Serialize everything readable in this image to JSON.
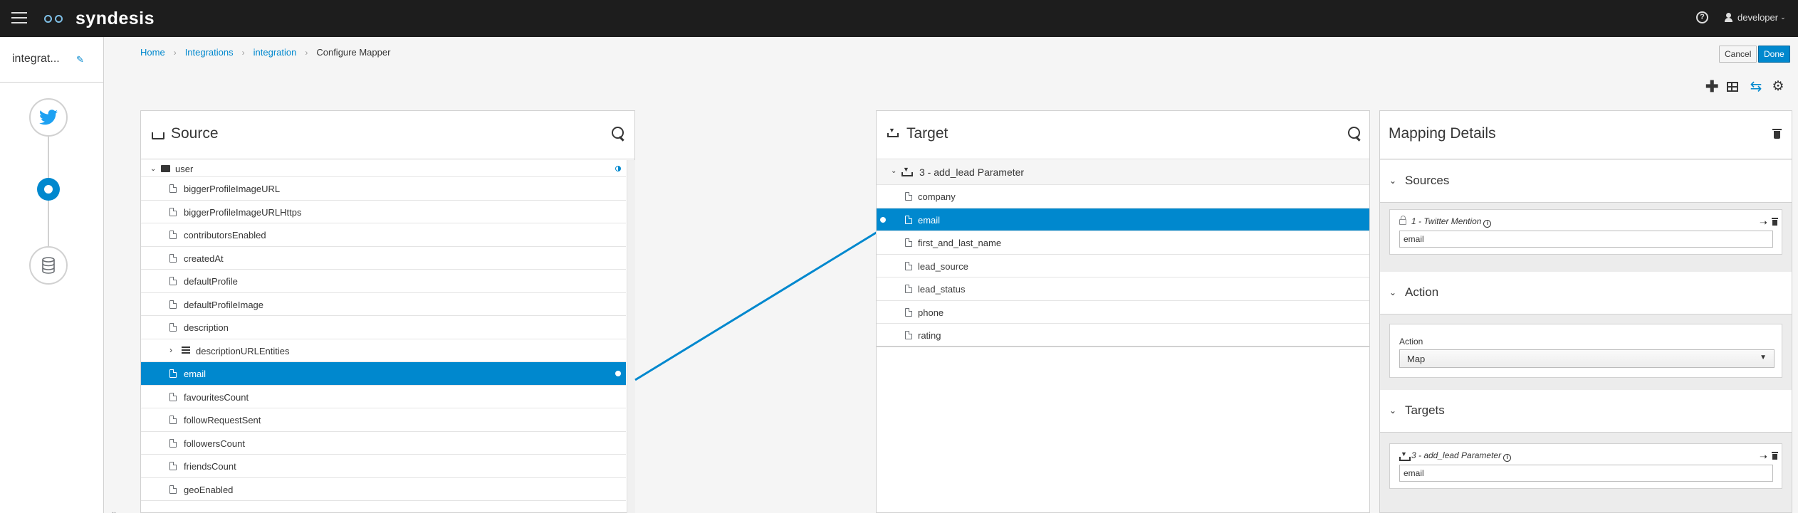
{
  "app": {
    "name": "syndesis"
  },
  "topbar": {
    "user": "developer"
  },
  "rail": {
    "title": "integrat...",
    "collapse_glyph": "»"
  },
  "breadcrumb": {
    "home": "Home",
    "integrations": "Integrations",
    "integration": "integration",
    "current": "Configure Mapper"
  },
  "actions": {
    "cancel": "Cancel",
    "done": "Done"
  },
  "source": {
    "title": "Source",
    "parent": "user",
    "items": [
      "biggerProfileImageURL",
      "biggerProfileImageURLHttps",
      "contributorsEnabled",
      "createdAt",
      "defaultProfile",
      "defaultProfileImage",
      "description",
      "descriptionURLEntities",
      "email",
      "favouritesCount",
      "followRequestSent",
      "followersCount",
      "friendsCount",
      "geoEnabled"
    ],
    "selected": "email"
  },
  "target": {
    "title": "Target",
    "group": "3 - add_lead Parameter",
    "items": [
      "company",
      "email",
      "first_and_last_name",
      "lead_source",
      "lead_status",
      "phone",
      "rating"
    ],
    "selected": "email"
  },
  "details": {
    "title": "Mapping Details",
    "sources_label": "Sources",
    "source_card": {
      "label": "1 - Twitter Mention",
      "value": "email"
    },
    "action_label": "Action",
    "action_field_label": "Action",
    "action_value": "Map",
    "targets_label": "Targets",
    "target_card": {
      "label": "3 - add_lead Parameter",
      "value": "email"
    }
  },
  "colors": {
    "accent": "#0088ce",
    "topbar": "#1d1d1d"
  },
  "icons": [
    "hamburger-icon",
    "help-icon",
    "user-icon",
    "pencil-icon",
    "twitter-icon",
    "database-icon",
    "search-icon",
    "plus-icon",
    "table-icon",
    "swap-icon",
    "gear-icon",
    "trash-icon"
  ]
}
